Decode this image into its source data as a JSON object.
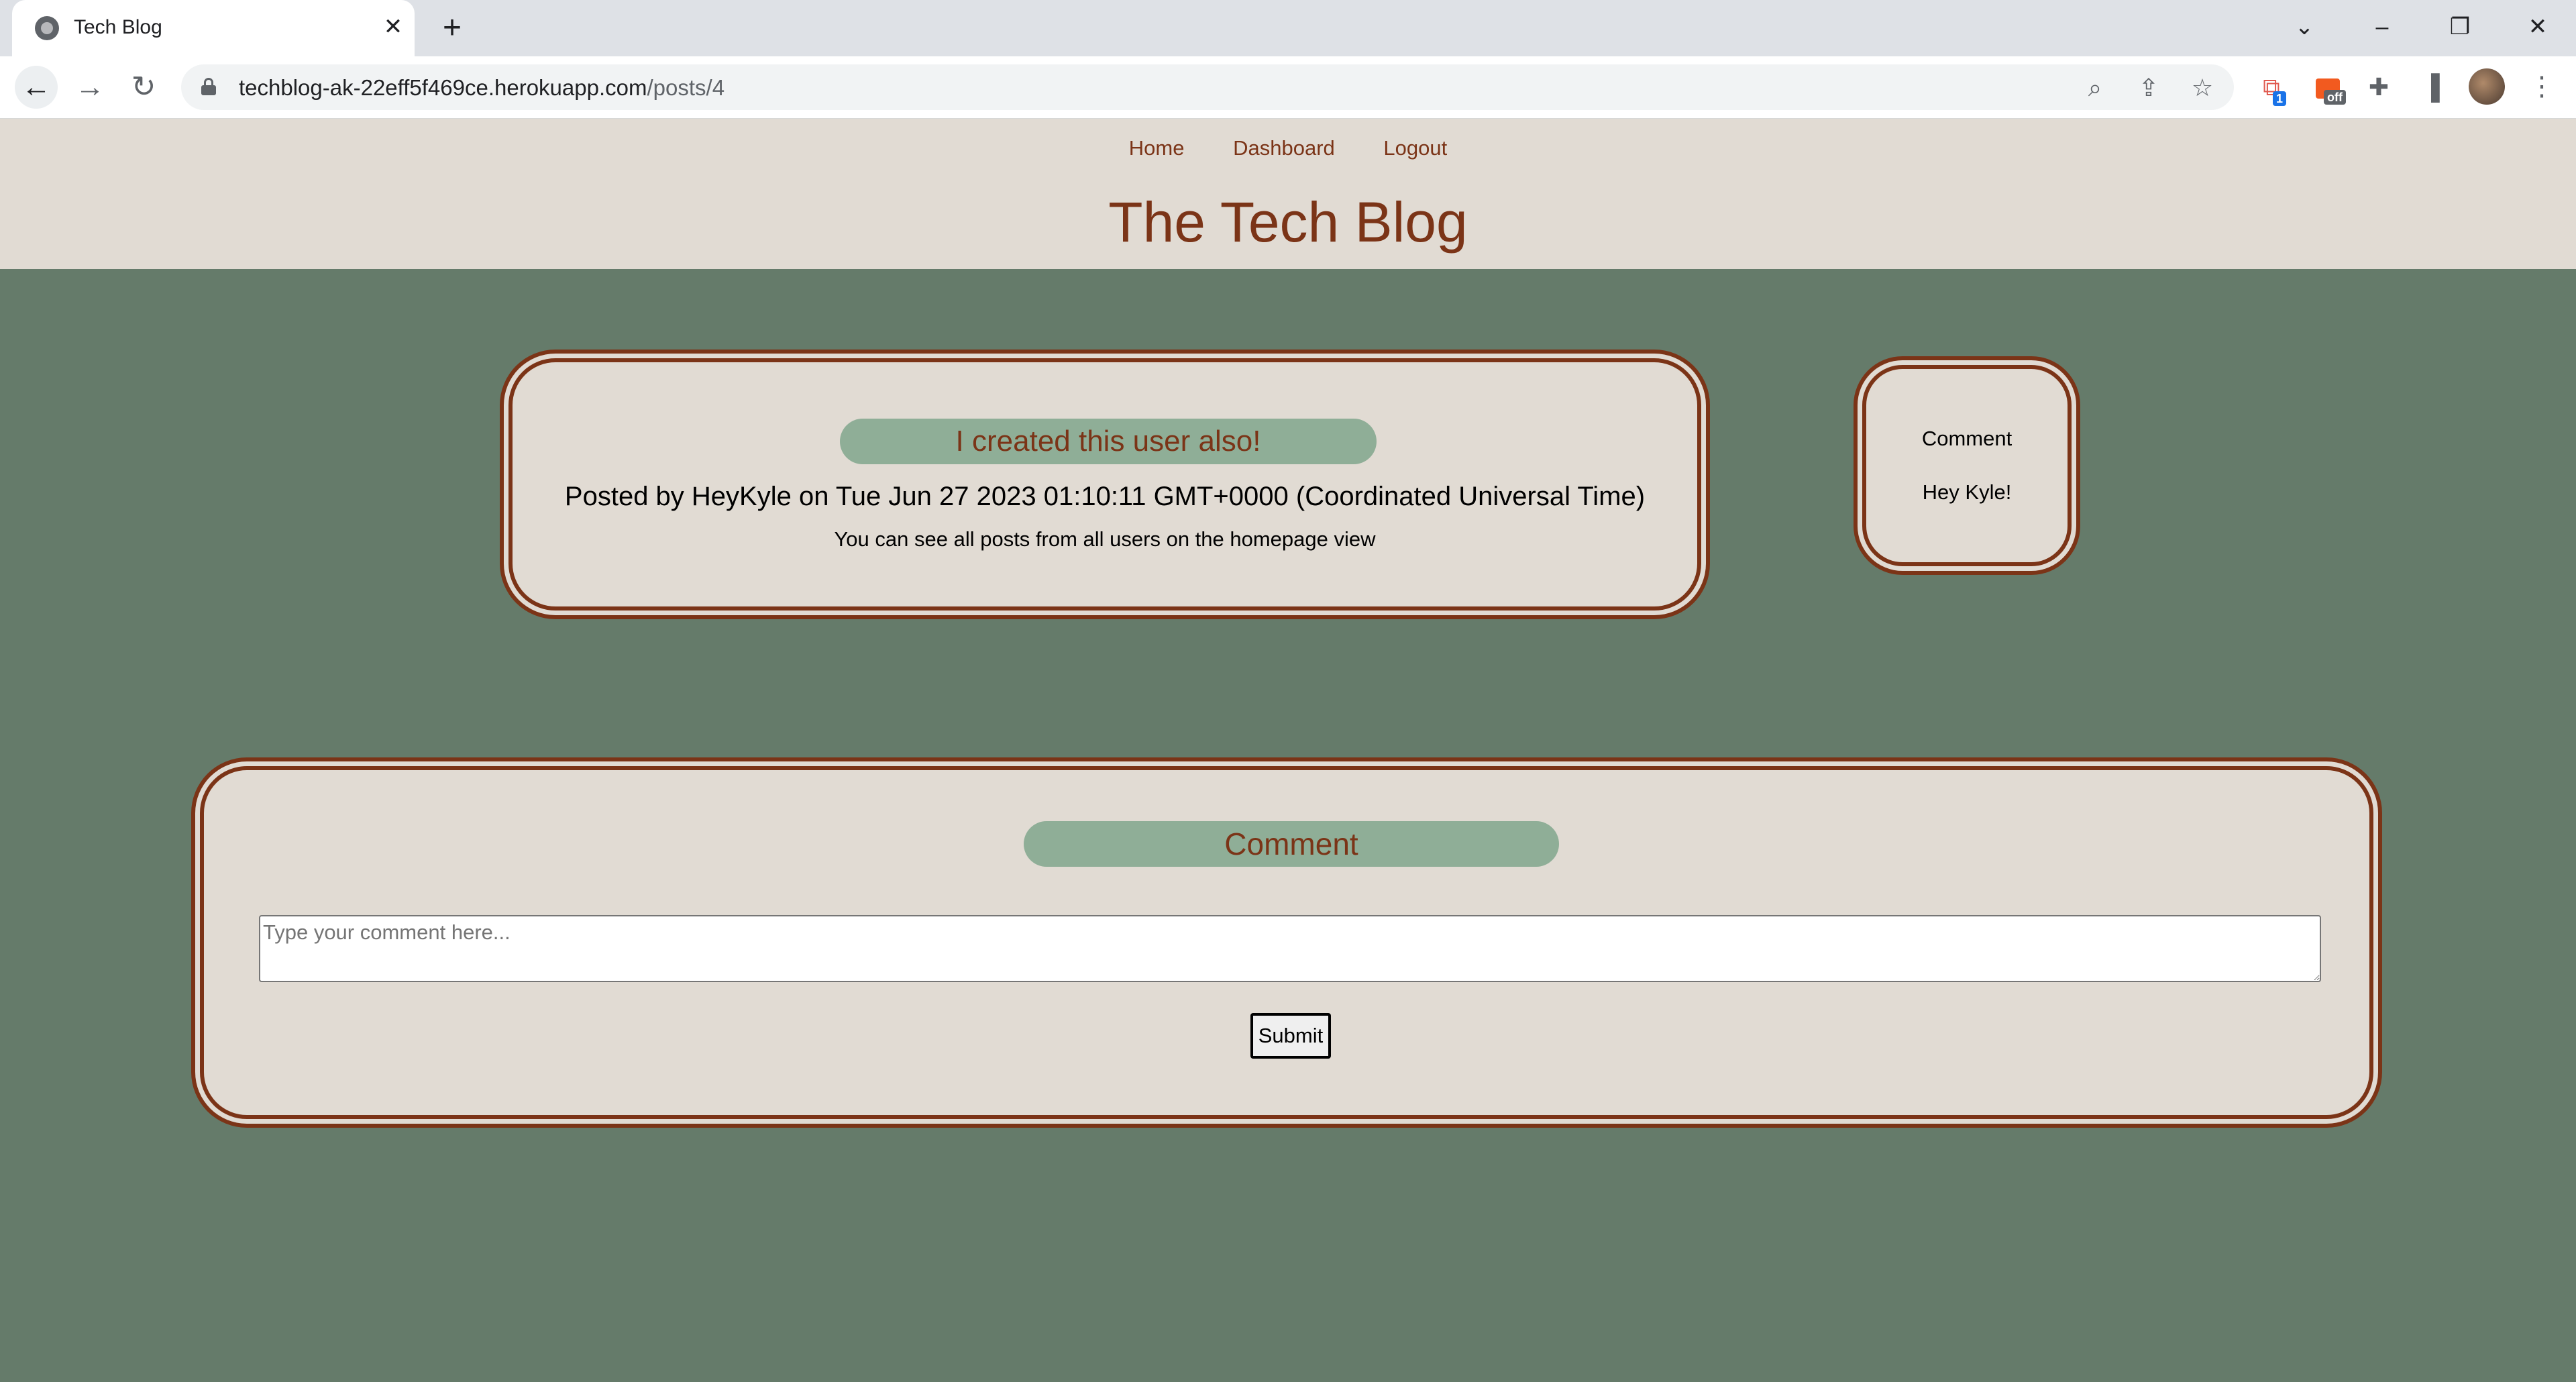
{
  "browser": {
    "tab_title": "Tech Blog",
    "url_host": "techblog-ak-22eff5f469ce.herokuapp.com",
    "url_path": "/posts/4",
    "extension_badges": [
      "1",
      "off"
    ]
  },
  "nav": {
    "home": "Home",
    "dashboard": "Dashboard",
    "logout": "Logout"
  },
  "site": {
    "title": "The Tech Blog"
  },
  "post": {
    "title": "I created this user also!",
    "meta": "Posted by HeyKyle on Tue Jun 27 2023 01:10:11 GMT+0000 (Coordinated Universal Time)",
    "body": "You can see all posts from all users on the homepage view"
  },
  "comments": {
    "heading": "Comment",
    "items": [
      "Hey Kyle!"
    ]
  },
  "comment_form": {
    "heading": "Comment",
    "placeholder": "Type your comment here...",
    "submit_label": "Submit"
  },
  "colors": {
    "page_background": "#657b6a",
    "card_background": "#e1dbd3",
    "accent_brown": "#7b3417",
    "pill_green": "#8fae97"
  }
}
